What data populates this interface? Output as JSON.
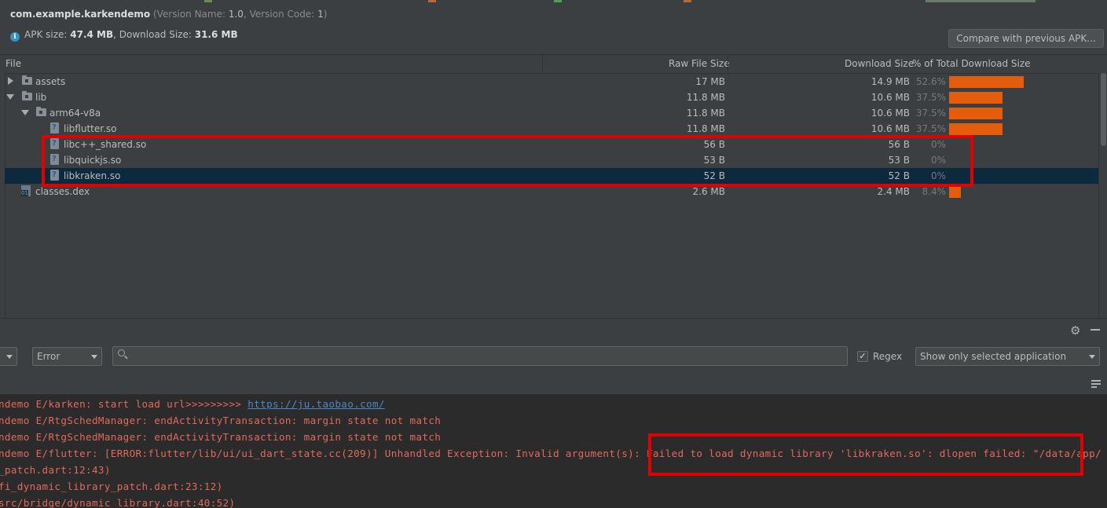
{
  "apk": {
    "package": "com.example.karkendemo",
    "version_prefix": "(Version Name: ",
    "version_name": "1.0",
    "version_mid": ", Version Code: ",
    "version_code": "1",
    "version_suffix": ")",
    "apk_size_label": "APK size: ",
    "apk_size": "47.4 MB",
    "download_size_label": ", Download Size: ",
    "download_size": "31.6 MB",
    "compare_button": "Compare with previous APK..."
  },
  "table": {
    "columns": [
      "File",
      "Raw File Size",
      "Download Size",
      "% of Total Download Size"
    ],
    "rows": [
      {
        "name": "assets",
        "raw": "17 MB",
        "download": "14.9 MB",
        "percent": "52.6%",
        "share": 0.526
      },
      {
        "name": "lib",
        "raw": "11.8 MB",
        "download": "10.6 MB",
        "percent": "37.5%",
        "share": 0.375
      },
      {
        "name": "arm64-v8a",
        "raw": "11.8 MB",
        "download": "10.6 MB",
        "percent": "37.5%",
        "share": 0.375
      },
      {
        "name": "libflutter.so",
        "raw": "11.8 MB",
        "download": "10.6 MB",
        "percent": "37.5%",
        "share": 0.375
      },
      {
        "name": "libc++_shared.so",
        "raw": "56 B",
        "download": "56 B",
        "percent": "0%",
        "share": 0
      },
      {
        "name": "libquickjs.so",
        "raw": "53 B",
        "download": "53 B",
        "percent": "0%",
        "share": 0
      },
      {
        "name": "libkraken.so",
        "raw": "52 B",
        "download": "52 B",
        "percent": "0%",
        "share": 0
      },
      {
        "name": "classes.dex",
        "raw": "2.6 MB",
        "download": "2.4 MB",
        "percent": "8.4%",
        "share": 0.084
      }
    ]
  },
  "logcat": {
    "level": "Error",
    "search_value": "",
    "regex_label": "Regex",
    "regex_checked": "✓",
    "filter": "Show only selected application",
    "lines": {
      "l1_text": "ndemo E/karken: start load url>>>>>>>>> ",
      "l1_link": "https://ju.taobao.com/",
      "l2": "ndemo E/RtgSchedManager: endActivityTransaction: margin state not match",
      "l3": "ndemo E/RtgSchedManager: endActivityTransaction: margin state not match",
      "l4": "ndemo E/flutter: [ERROR:flutter/lib/ui/ui_dart_state.cc(209)] Unhandled Exception: Invalid argument(s): Failed to load dynamic library 'libkraken.so': dlopen failed: \"/data/app/",
      "l5": "_patch.dart:12:43)",
      "l6": "fi_dynamic_library_patch.dart:23:12)",
      "l7": "src/bridge/dynamic_library.dart:40:52)"
    }
  },
  "colors": {
    "bar": "#e35d0c",
    "selection": "#0d293e",
    "annotation": "#e30000",
    "error_text": "#e06a5c",
    "link": "#4a88c7"
  },
  "icons": [
    "info-icon",
    "folder-icon",
    "so-file-icon",
    "dex-file-icon",
    "gear-icon",
    "minimize-icon",
    "search-icon",
    "soft-wrap-icon"
  ]
}
